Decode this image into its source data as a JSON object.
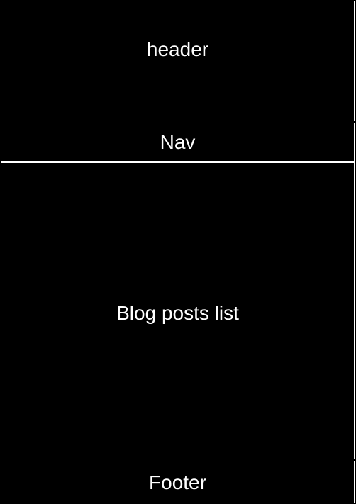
{
  "layout_blocks": {
    "header": "header",
    "nav": "Nav",
    "main": "Blog posts list",
    "footer": "Footer"
  },
  "colors": {
    "background": "#000000",
    "border": "#ffffff",
    "text": "#ffffff"
  }
}
